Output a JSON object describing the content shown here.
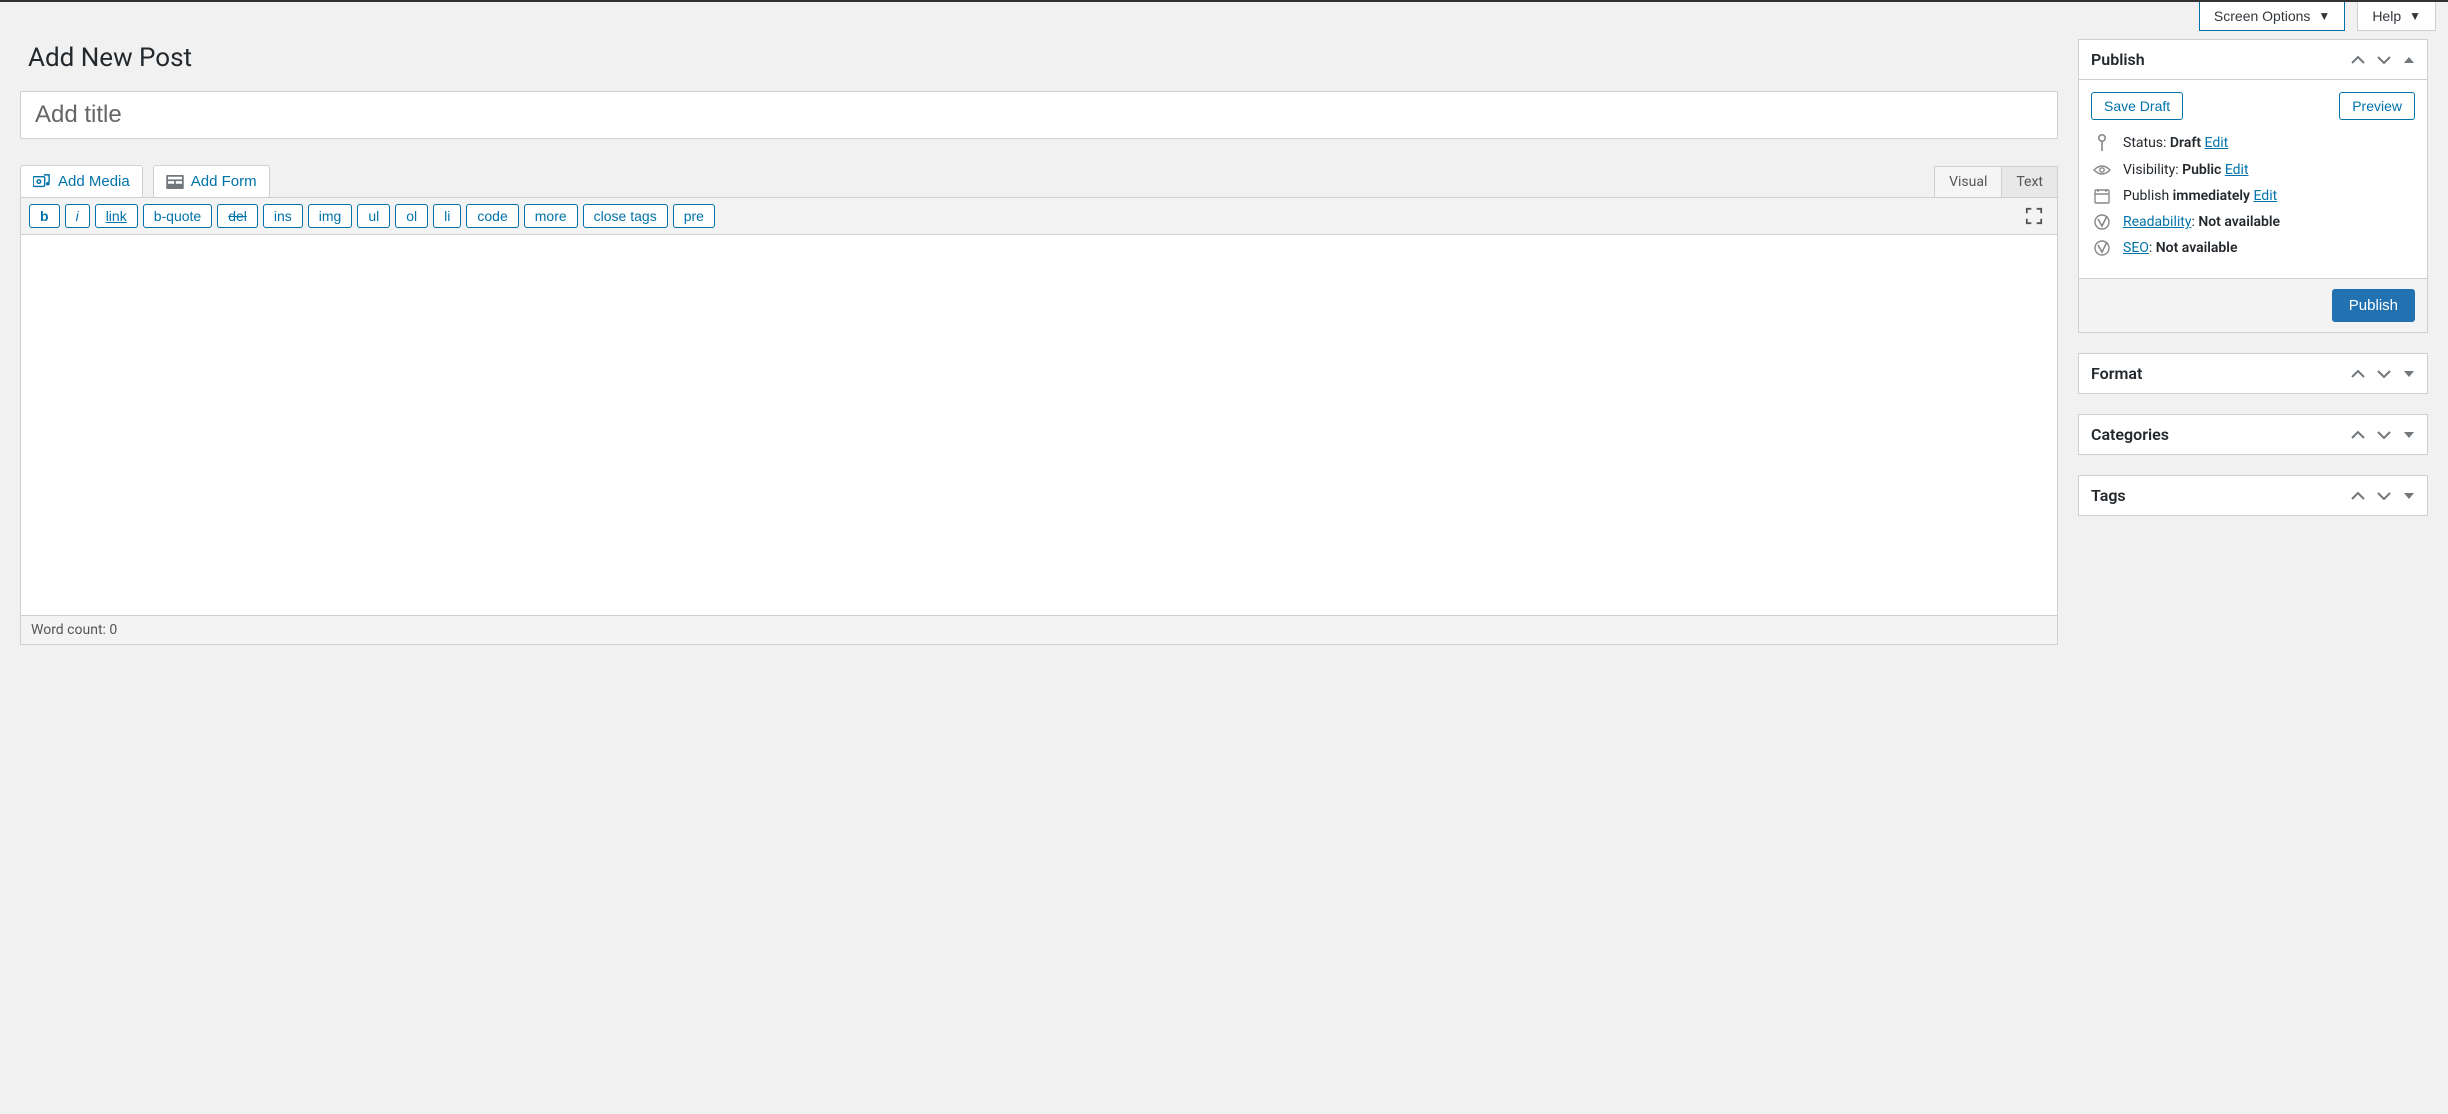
{
  "topbar": {
    "screen_options": "Screen Options",
    "help": "Help"
  },
  "heading": "Add New Post",
  "title_placeholder": "Add title",
  "media": {
    "add_media": "Add Media",
    "add_form": "Add Form"
  },
  "editor_tabs": {
    "visual": "Visual",
    "text": "Text"
  },
  "toolbar": {
    "b": "b",
    "i": "i",
    "link": "link",
    "bquote": "b-quote",
    "del": "del",
    "ins": "ins",
    "img": "img",
    "ul": "ul",
    "ol": "ol",
    "li": "li",
    "code": "code",
    "more": "more",
    "close_tags": "close tags",
    "pre": "pre"
  },
  "footer": {
    "word_count_label": "Word count: ",
    "word_count": "0"
  },
  "publish": {
    "title": "Publish",
    "save_draft": "Save Draft",
    "preview": "Preview",
    "status_label": "Status: ",
    "status_value": "Draft",
    "visibility_label": "Visibility: ",
    "visibility_value": "Public",
    "publish_label": "Publish ",
    "publish_value": "immediately",
    "edit": "Edit",
    "readability_label": "Readability",
    "readability_value": "Not available",
    "seo_label": "SEO",
    "seo_value": "Not available",
    "publish_button": "Publish"
  },
  "format": {
    "title": "Format"
  },
  "categories": {
    "title": "Categories"
  },
  "tags": {
    "title": "Tags"
  },
  "colon_sep": ": "
}
